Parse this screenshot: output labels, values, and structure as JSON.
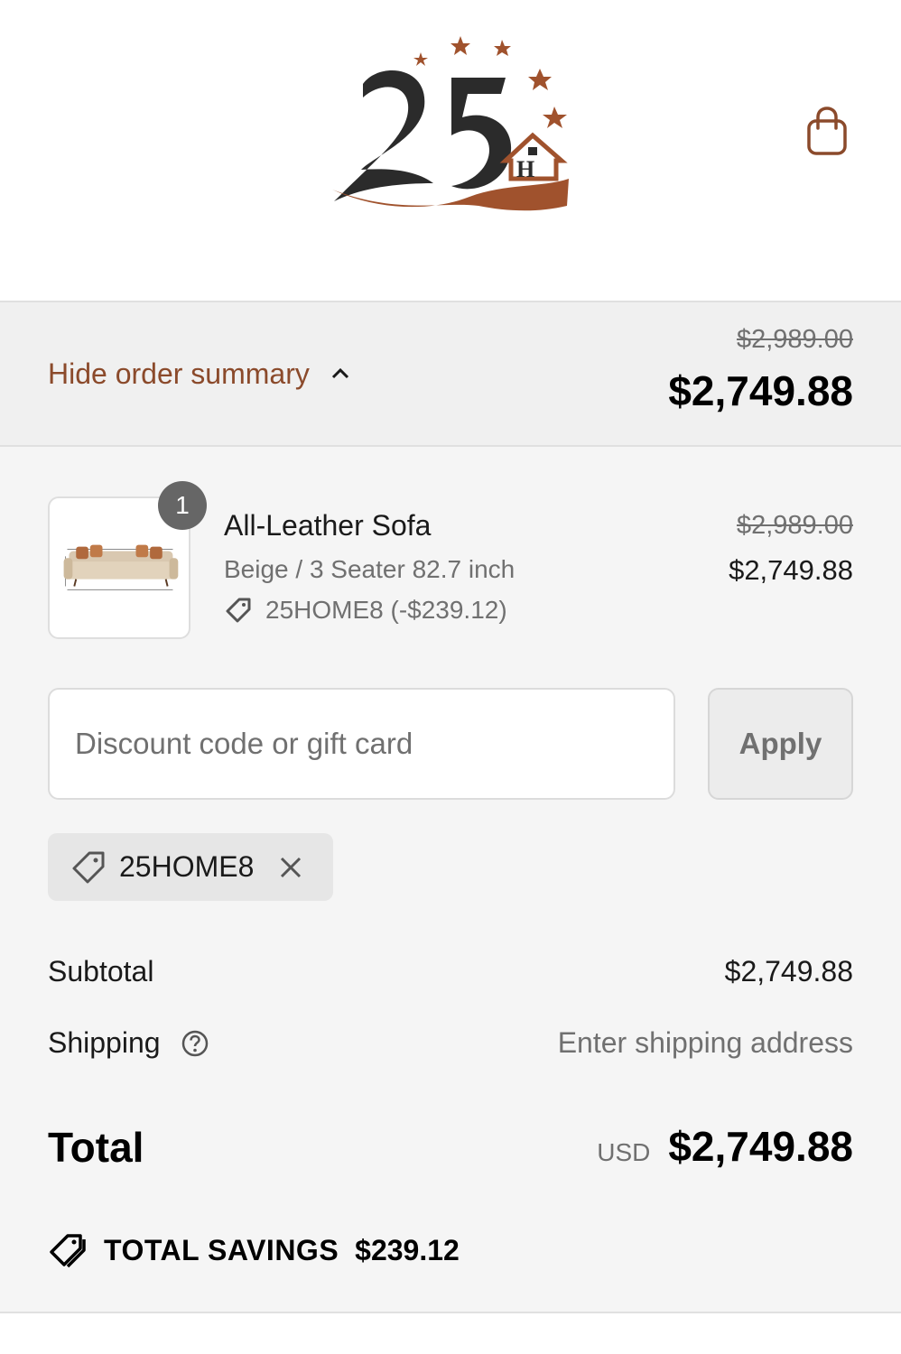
{
  "header": {
    "logo_alt": "25H",
    "logo_icon": "brand-logo-25h",
    "cart_icon": "shopping-bag-icon",
    "colors": {
      "brand_brown": "#a0522d",
      "logo_dark": "#2b2b2b"
    }
  },
  "summary_toggle": {
    "label": "Hide order summary",
    "icon": "chevron-up-icon",
    "compare_price": "$2,989.00",
    "total": "$2,749.88"
  },
  "line_item": {
    "quantity": "1",
    "name": "All-Leather Sofa",
    "variant": "Beige / 3 Seater 82.7 inch",
    "discount": "25HOME8 (-$239.12)",
    "compare_price": "$2,989.00",
    "price": "$2,749.88",
    "image_icon": "sofa-product-image"
  },
  "discount_form": {
    "placeholder": "Discount code or gift card",
    "value": "",
    "apply_label": "Apply"
  },
  "applied_code": {
    "label": "25HOME8",
    "icon": "tag-icon",
    "remove_icon": "close-icon"
  },
  "totals": {
    "subtotal_label": "Subtotal",
    "subtotal_value": "$2,749.88",
    "shipping_label": "Shipping",
    "shipping_value": "Enter shipping address",
    "total_label": "Total",
    "currency": "USD",
    "total_value": "$2,749.88",
    "savings_label": "TOTAL SAVINGS",
    "savings_value": "$239.12"
  }
}
